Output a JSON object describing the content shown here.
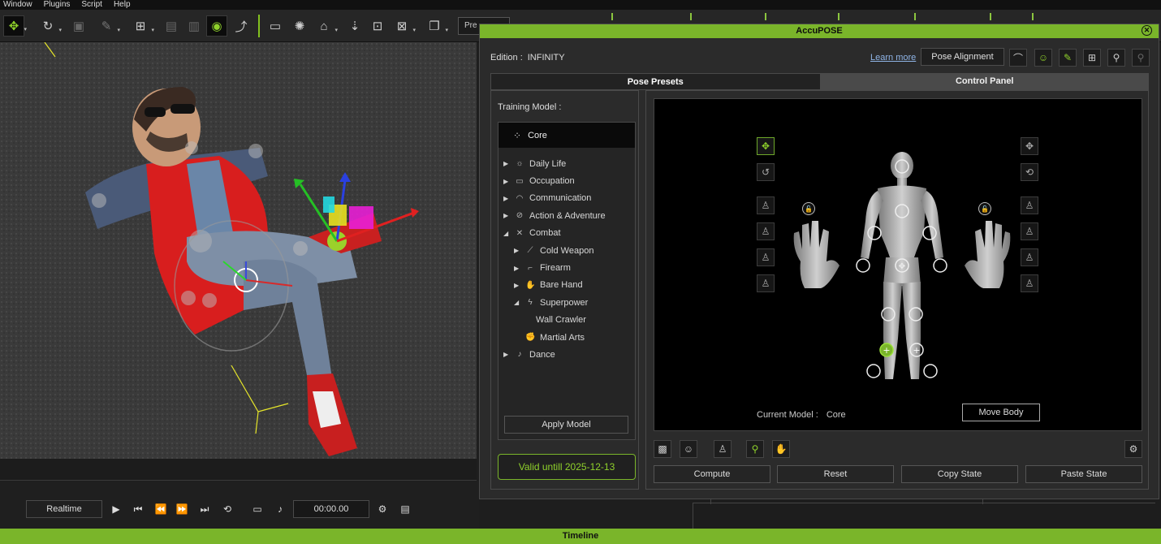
{
  "menu": [
    "Window",
    "Plugins",
    "Script",
    "Help"
  ],
  "toolbar": {
    "icons": [
      "move-icon",
      "rotate-icon",
      "scale-icon",
      "pick-icon",
      "align-icon",
      "snap-icon",
      "snap2-icon",
      "visibility-icon",
      "camera-up-icon",
      "layout-icon",
      "light-icon",
      "home-icon",
      "fit-icon",
      "frame-icon",
      "render-icon",
      "camera-icon"
    ],
    "preset_label": "Pre"
  },
  "playback": {
    "realtime": "Realtime",
    "time": "00:00.00"
  },
  "timeline_title": "Timeline",
  "dialog": {
    "title": "AccuPOSE",
    "edition_label": "Edition :",
    "edition_value": "INFINITY",
    "learn_more": "Learn more",
    "pose_alignment": "Pose Alignment",
    "tabs": [
      "Pose Presets",
      "Control Panel"
    ],
    "training_model_label": "Training Model :",
    "core_label": "Core",
    "tree": [
      {
        "label": "Daily Life",
        "arrow": "▶",
        "icon": "☼",
        "level": 0
      },
      {
        "label": "Occupation",
        "arrow": "▶",
        "icon": "▭",
        "level": 0
      },
      {
        "label": "Communication",
        "arrow": "▶",
        "icon": "◠",
        "level": 0
      },
      {
        "label": "Action & Adventure",
        "arrow": "▶",
        "icon": "⊘",
        "level": 0
      },
      {
        "label": "Combat",
        "arrow": "◢",
        "icon": "✕",
        "level": 0
      },
      {
        "label": "Cold Weapon",
        "arrow": "▶",
        "icon": "⟋",
        "level": 1
      },
      {
        "label": "Firearm",
        "arrow": "▶",
        "icon": "⌐",
        "level": 1
      },
      {
        "label": "Bare Hand",
        "arrow": "▶",
        "icon": "✋",
        "level": 1
      },
      {
        "label": "Superpower",
        "arrow": "◢",
        "icon": "ϟ",
        "level": 1
      },
      {
        "label": "Wall Crawler",
        "arrow": "",
        "icon": "",
        "level": 2
      },
      {
        "label": "Martial Arts",
        "arrow": "",
        "icon": "✊",
        "level": 1
      },
      {
        "label": "Dance",
        "arrow": "▶",
        "icon": "♪",
        "level": 0
      }
    ],
    "apply_model": "Apply Model",
    "valid_until": "Valid untill 2025-12-13",
    "current_model_label": "Current Model :",
    "current_model_value": "Core",
    "move_body": "Move Body",
    "actions": [
      "Compute",
      "Reset",
      "Copy State",
      "Paste State"
    ]
  },
  "colors": {
    "accent": "#7ab52a",
    "accent_bright": "#8fd12b",
    "link": "#8fb4e6"
  }
}
